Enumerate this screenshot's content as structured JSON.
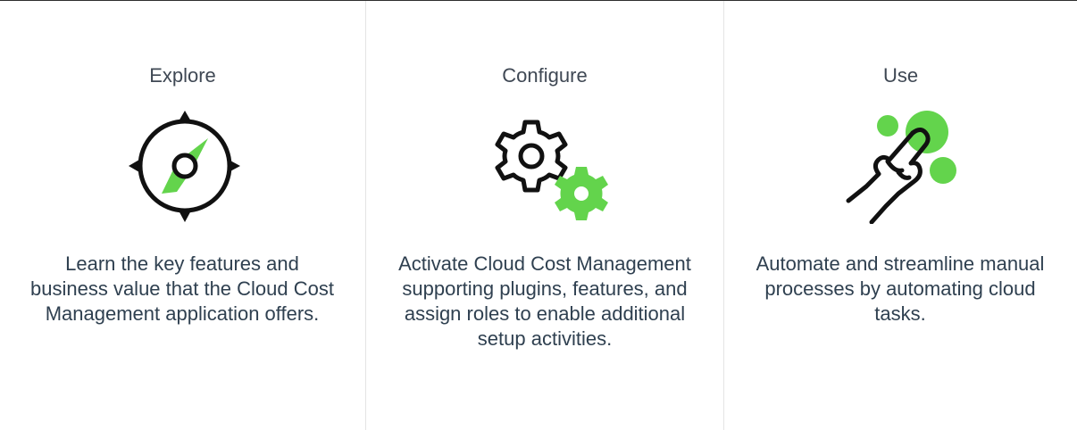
{
  "cards": [
    {
      "title": "Explore",
      "icon": "compass-icon",
      "description": "Learn the key features and business value that the Cloud Cost Management application offers."
    },
    {
      "title": "Configure",
      "icon": "gears-icon",
      "description": "Activate Cloud Cost Management supporting plugins, features, and assign roles to enable additional setup activities."
    },
    {
      "title": "Use",
      "icon": "hand-pointer-icon",
      "description": "Automate and streamline manual processes by automating cloud tasks."
    }
  ],
  "colors": {
    "accent_green": "#63d44c",
    "icon_stroke": "#111111",
    "text": "#2f4050",
    "divider": "#e4e4e4"
  }
}
